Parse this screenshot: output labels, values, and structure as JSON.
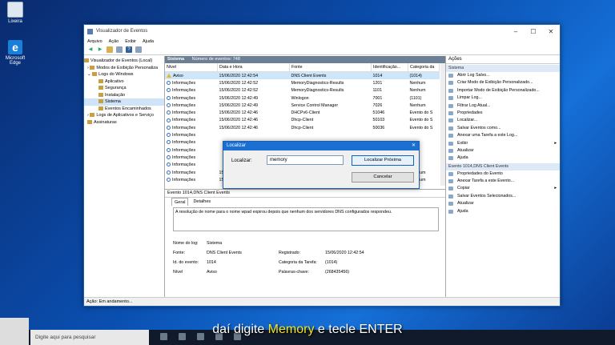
{
  "desktop": {
    "recycle_label": "Lixeira",
    "edge_label": "Microsoft Edge"
  },
  "window": {
    "title": "Visualizador de Eventos",
    "menu": [
      "Arquivo",
      "Ação",
      "Exibir",
      "Ajuda"
    ],
    "status": "Ação:  Em andamento..."
  },
  "tree": [
    "Visualizador de Eventos (Local)",
    "Modos de Exibição Personaliza",
    "Logs do Windows",
    "Aplicativo",
    "Segurança",
    "Instalação",
    "Sistema",
    "Eventos Encaminhados",
    "Logs de Aplicativos e Serviço",
    "Assinaturas"
  ],
  "log_header": {
    "name": "Sistema",
    "count": "Número de eventos: 748"
  },
  "columns": [
    "Nível",
    "Data e Hora",
    "Fonte",
    "Identificação...",
    "Categoria da"
  ],
  "events": [
    [
      "Aviso",
      "15/06/2020 12:42:54",
      "DNS Client Events",
      "1014",
      "(1014)"
    ],
    [
      "Informações",
      "15/06/2020 12:42:52",
      "MemoryDiagnostics-Results",
      "1201",
      "Nenhum"
    ],
    [
      "Informações",
      "15/06/2020 12:42:52",
      "MemoryDiagnostics-Results",
      "1101",
      "Nenhum"
    ],
    [
      "Informações",
      "15/06/2020 12:42:49",
      "Winlogon",
      "7001",
      "(1101)"
    ],
    [
      "Informações",
      "15/06/2020 12:42:49",
      "Service Control Manager",
      "7026",
      "Nenhum"
    ],
    [
      "Informações",
      "15/06/2020 12:42:46",
      "DHCPv6-Client",
      "51046",
      "Evento do S"
    ],
    [
      "Informações",
      "15/06/2020 12:42:46",
      "Dhcp-Client",
      "50103",
      "Evento do S"
    ],
    [
      "Informações",
      "15/06/2020 12:42:46",
      "Dhcp-Client",
      "50036",
      "Evento do S"
    ],
    [
      "Informações",
      "",
      "",
      "",
      ""
    ],
    [
      "Informações",
      "",
      "",
      "",
      ""
    ],
    [
      "Informações",
      "",
      "",
      "",
      ""
    ],
    [
      "Informações",
      "",
      "",
      "",
      ""
    ],
    [
      "Informações",
      "",
      "",
      "",
      ""
    ],
    [
      "Informações",
      "15/06/2020 12:42:45",
      "Directory-Services-SAM",
      "16962",
      "Nenhum"
    ],
    [
      "Informações",
      "15/06/2020 12:42:45",
      "Wininit",
      "",
      "Nenhum"
    ]
  ],
  "detail": {
    "header": "Evento 1014,DNS Client Events",
    "tabs": [
      "Geral",
      "Detalhes"
    ],
    "message": "A resolução de nome para o nome wpad expirou depois que nenhum dos servidores DNS configurados respondeu.",
    "fields": {
      "log_name_label": "Nome do log:",
      "log_name": "Sistema",
      "source_label": "Fonte:",
      "source": "DNS Client Events",
      "recorded_label": "Registrado:",
      "recorded": "15/06/2020 12:42:54",
      "event_id_label": "Id. do evento:",
      "event_id": "1014",
      "task_label": "Categoria da Tarefa:",
      "task": "(1014)",
      "level_label": "Nível",
      "level": "Aviso",
      "keywords_label": "Palavras-chave:",
      "keywords": "(268435456)"
    }
  },
  "actions": {
    "title": "Ações",
    "section1": "Sistema",
    "items1": [
      "Abrir Log Salvo...",
      "Criar Modo de Exibição Personalizado...",
      "Importar Modo de Exibição Personalizado...",
      "Limpar Log...",
      "Filtrar Log Atual...",
      "Propriedades",
      "Localizar...",
      "Salvar Eventos como...",
      "Anexar uma Tarefa a este Log...",
      "Exibir",
      "Atualizar",
      "Ajuda"
    ],
    "section2": "Evento 1014,DNS Client Events",
    "items2": [
      "Propriedades do Evento",
      "Anexar Tarefa a este Evento...",
      "Copiar",
      "Salvar Eventos Selecionados...",
      "Atualizar",
      "Ajuda"
    ]
  },
  "dialog": {
    "title": "Localizar",
    "label": "Localizar:",
    "value": "memory",
    "find_next": "Localizar Próxima",
    "cancel": "Cancelar"
  },
  "taskbar": {
    "search_placeholder": "Digite aqui para pesquisar"
  },
  "subtitle": {
    "before": "daí digite ",
    "highlight": "Memory",
    "after": " e tecle ENTER"
  }
}
